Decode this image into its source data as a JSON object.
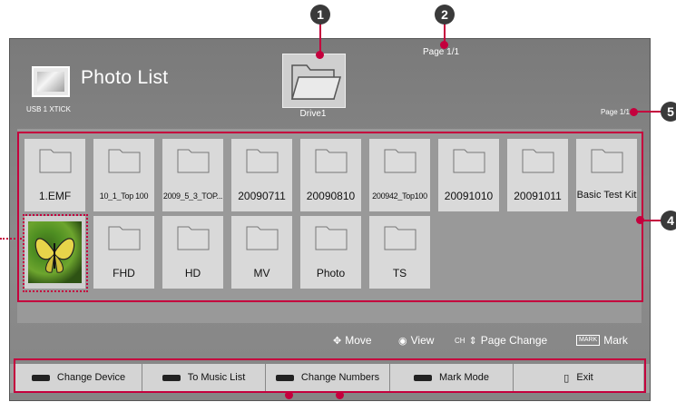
{
  "callouts": {
    "c1": "1",
    "c2": "2",
    "c4": "4",
    "c5": "5"
  },
  "header": {
    "title": "Photo List",
    "device": "USB 1 XTICK",
    "drive_label": "Drive1",
    "page_top": "Page 1/1",
    "page_right": "Page 1/1"
  },
  "tiles_row1": [
    {
      "label": "1.EMF"
    },
    {
      "label": "10_1_Top 100"
    },
    {
      "label": "2009_5_3_TOP..."
    },
    {
      "label": "20090711"
    },
    {
      "label": "20090810"
    },
    {
      "label": "200942_Top100"
    },
    {
      "label": "20091010"
    },
    {
      "label": "20091011"
    },
    {
      "label": "Basic Test Kit"
    }
  ],
  "tiles_row2": [
    {
      "label": "FHD"
    },
    {
      "label": "HD"
    },
    {
      "label": "MV"
    },
    {
      "label": "Photo"
    },
    {
      "label": "TS"
    }
  ],
  "hints": {
    "move": "Move",
    "view": "View",
    "ch": "CH",
    "page_change": "Page Change",
    "mark_badge": "MARK",
    "mark": "Mark"
  },
  "bottom_bar": {
    "change_device": "Change Device",
    "to_music_list": "To Music List",
    "change_numbers": "Change Numbers",
    "mark_mode": "Mark Mode",
    "exit": "Exit"
  },
  "colors": {
    "accent": "#c4003d",
    "screen": "#858585",
    "tile": "#d9d9d9"
  }
}
